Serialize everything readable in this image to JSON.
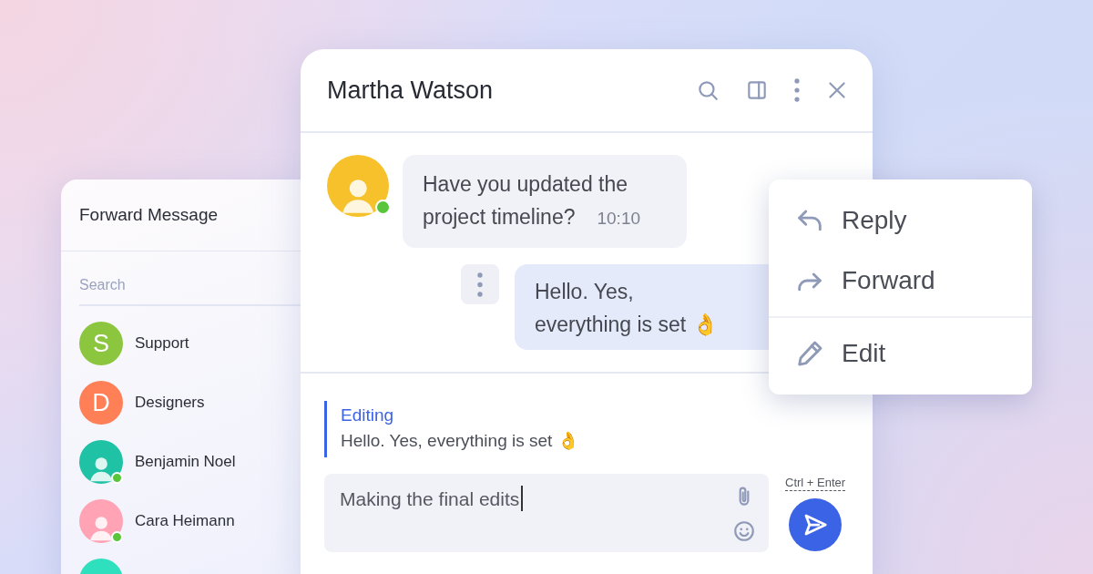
{
  "forward_panel": {
    "title": "Forward Message",
    "search": {
      "placeholder": "Search"
    },
    "contacts": [
      {
        "name": "Support",
        "kind": "initial",
        "initial": "S",
        "color": "#8cc63f",
        "online": false
      },
      {
        "name": "Designers",
        "kind": "initial",
        "initial": "D",
        "color": "#ff7f57",
        "online": false
      },
      {
        "name": "Benjamin Noel",
        "kind": "photo",
        "color": "#1fc2a4",
        "online": true
      },
      {
        "name": "Cara Heimann",
        "kind": "photo",
        "color": "#ffa3b5",
        "online": true
      },
      {
        "kind": "photo",
        "color": "#2fe0bf",
        "online": false
      }
    ]
  },
  "chat": {
    "title": "Martha Watson",
    "messages": [
      {
        "kind": "incoming",
        "text": "Have you updated the project timeline?",
        "time": "10:10",
        "color": "#f6c12a",
        "online": true
      },
      {
        "kind": "outgoing",
        "lines": [
          "Hello. Yes,",
          "everything is set 👌"
        ]
      }
    ],
    "editing": {
      "label": "Editing",
      "text": "Hello. Yes, everything is set 👌"
    },
    "composer": {
      "value": "Making the final edits",
      "shortcut": "Ctrl + Enter"
    }
  },
  "context_menu": {
    "items": [
      {
        "label": "Reply",
        "kind": "reply",
        "divider_before": false
      },
      {
        "label": "Forward",
        "kind": "forward",
        "divider_before": false
      },
      {
        "label": "Edit",
        "kind": "edit",
        "divider_before": true
      }
    ]
  }
}
